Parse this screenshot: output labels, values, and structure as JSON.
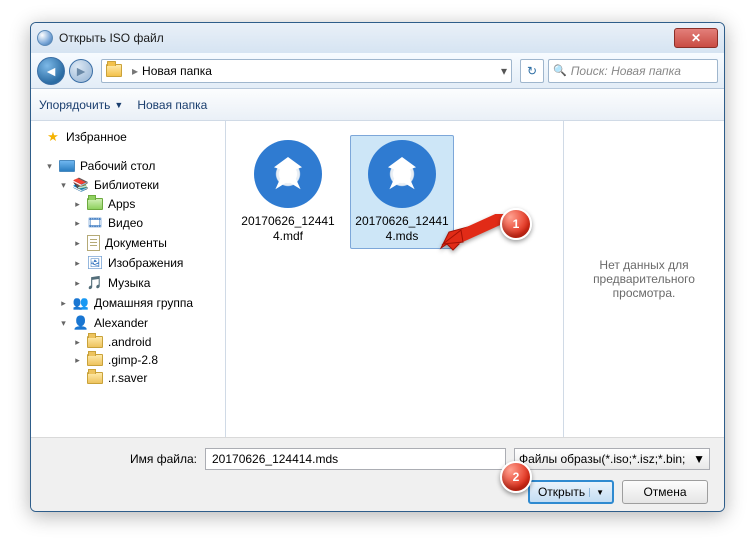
{
  "window": {
    "title": "Открыть ISO файл"
  },
  "path": {
    "current": "Новая папка"
  },
  "search": {
    "placeholder": "Поиск: Новая папка"
  },
  "toolbar": {
    "organize": "Упорядочить",
    "newfolder": "Новая папка"
  },
  "tree": {
    "favorites": "Избранное",
    "desktop": "Рабочий стол",
    "libraries": "Библиотеки",
    "apps": "Apps",
    "video": "Видео",
    "documents": "Документы",
    "images": "Изображения",
    "music": "Музыка",
    "homegroup": "Домашняя группа",
    "user": "Alexander",
    "f_android": ".android",
    "f_gimp": ".gimp-2.8",
    "f_rsaver": ".r.saver"
  },
  "files": [
    {
      "name": "20170626_124414.mdf"
    },
    {
      "name": "20170626_124414.mds"
    }
  ],
  "preview": {
    "empty": "Нет данных для предварительного просмотра."
  },
  "bottom": {
    "filename_label": "Имя файла:",
    "filename_value": "20170626_124414.mds",
    "filter": "Файлы образы(*.iso;*.isz;*.bin;",
    "open": "Открыть",
    "cancel": "Отмена"
  },
  "callouts": {
    "one": "1",
    "two": "2"
  }
}
